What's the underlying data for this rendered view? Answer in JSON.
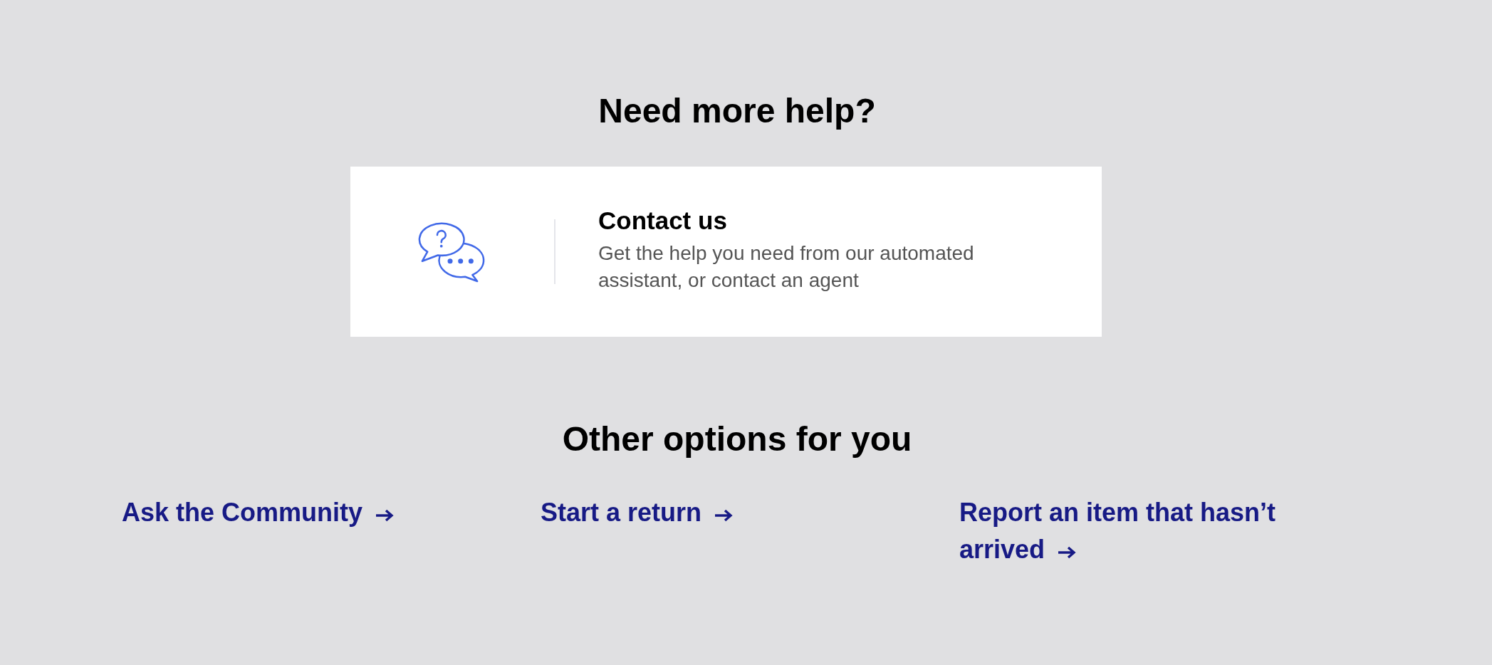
{
  "heading": "Need more help?",
  "contact_card": {
    "title": "Contact us",
    "description": "Get the help you need from our automated assistant, or contact an agent"
  },
  "other_options": {
    "heading": "Other options for you",
    "links": [
      {
        "label": "Ask the Community"
      },
      {
        "label": "Start a return"
      },
      {
        "label": "Report an item that hasn’t arrived"
      }
    ]
  }
}
